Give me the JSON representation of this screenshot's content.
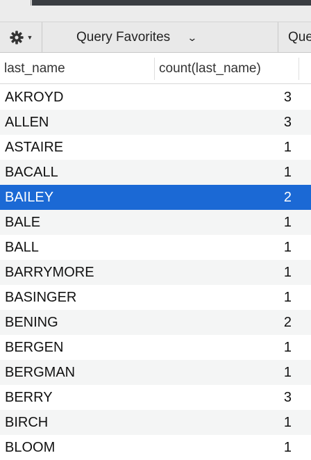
{
  "toolbar": {
    "gear_icon": "gear-icon",
    "favorites_label": "Query Favorites",
    "favorites_chevron": "⌄",
    "next_label": "Que"
  },
  "table": {
    "columns": [
      "last_name",
      "count(last_name)"
    ],
    "rows": [
      {
        "last_name": "AKROYD",
        "count": "3",
        "selected": false
      },
      {
        "last_name": "ALLEN",
        "count": "3",
        "selected": false
      },
      {
        "last_name": "ASTAIRE",
        "count": "1",
        "selected": false
      },
      {
        "last_name": "BACALL",
        "count": "1",
        "selected": false
      },
      {
        "last_name": "BAILEY",
        "count": "2",
        "selected": true
      },
      {
        "last_name": "BALE",
        "count": "1",
        "selected": false
      },
      {
        "last_name": "BALL",
        "count": "1",
        "selected": false
      },
      {
        "last_name": "BARRYMORE",
        "count": "1",
        "selected": false
      },
      {
        "last_name": "BASINGER",
        "count": "1",
        "selected": false
      },
      {
        "last_name": "BENING",
        "count": "2",
        "selected": false
      },
      {
        "last_name": "BERGEN",
        "count": "1",
        "selected": false
      },
      {
        "last_name": "BERGMAN",
        "count": "1",
        "selected": false
      },
      {
        "last_name": "BERRY",
        "count": "3",
        "selected": false
      },
      {
        "last_name": "BIRCH",
        "count": "1",
        "selected": false
      },
      {
        "last_name": "BLOOM",
        "count": "1",
        "selected": false
      }
    ]
  },
  "colors": {
    "selection": "#1b69d5",
    "alt_row": "#f4f5f5",
    "toolbar_bg": "#e9e9e9"
  }
}
